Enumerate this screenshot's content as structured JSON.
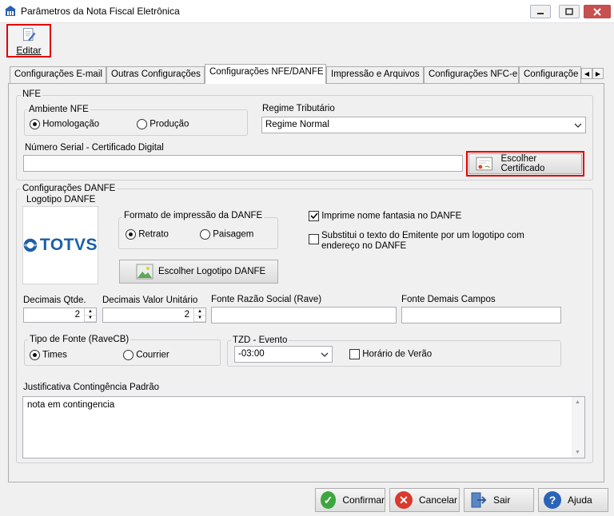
{
  "window": {
    "title": "Parâmetros da Nota Fiscal Eletrônica"
  },
  "toolbar": {
    "edit_label": "Editar"
  },
  "tabs": [
    "Configurações E-mail",
    "Outras Configurações",
    "Configurações NFE/DANFE",
    "Impressão e Arquivos",
    "Configurações NFC-e",
    "Configuraçõe"
  ],
  "nfe": {
    "group_label": "NFE",
    "ambiente": {
      "label": "Ambiente NFE",
      "options": [
        "Homologação",
        "Produção"
      ],
      "selected": "Homologação"
    },
    "regime": {
      "label": "Regime Tributário",
      "value": "Regime Normal"
    },
    "serial": {
      "label": "Número Serial - Certificado Digital",
      "value": ""
    },
    "cert_button": "Escolher Certificado"
  },
  "danfe": {
    "group_label": "Configurações DANFE",
    "logo_label": "Logotipo DANFE",
    "logo_text": "TOTVS",
    "formato": {
      "label": "Formato de impressão da DANFE",
      "options": [
        "Retrato",
        "Paisagem"
      ],
      "selected": "Retrato"
    },
    "logo_button": "Escolher Logotipo DANFE",
    "imprime_fantasia": {
      "label": "Imprime nome fantasia no DANFE",
      "checked": true
    },
    "substitui_emitente": {
      "label": "Substitui o texto do Emitente por um logotipo com endereço no DANFE",
      "checked": false
    },
    "decimais_qtde": {
      "label": "Decimais Qtde.",
      "value": "2"
    },
    "decimais_valor": {
      "label": "Decimais Valor Unitário",
      "value": "2"
    },
    "fonte_razao": {
      "label": "Fonte Razão Social (Rave)",
      "value": ""
    },
    "fonte_demais": {
      "label": "Fonte Demais Campos",
      "value": ""
    },
    "tipo_fonte": {
      "label": "Tipo de Fonte (RaveCB)",
      "options": [
        "Times",
        "Courrier"
      ],
      "selected": "Times"
    },
    "tzd": {
      "label": "TZD - Evento",
      "value": "-03:00"
    },
    "horario_verao": {
      "label": "Horário de Verão",
      "checked": false
    },
    "justificativa": {
      "label": "Justificativa Contingência Padrão",
      "value": "nota em contingencia"
    }
  },
  "footer": {
    "confirm": "Confirmar",
    "cancel": "Cancelar",
    "exit": "Sair",
    "help": "Ajuda"
  },
  "colors": {
    "highlight": "#e00000",
    "totvs_blue": "#1b5fa8",
    "confirm": "#3ea63e",
    "cancel": "#d83a2e",
    "help": "#2a64b8"
  }
}
